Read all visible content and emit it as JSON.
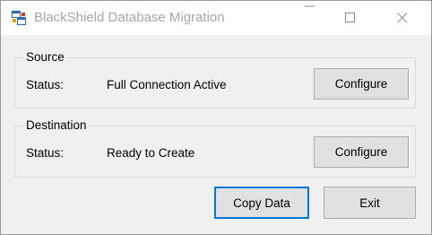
{
  "window": {
    "title": "BlackShield Database Migration",
    "icon": "app-window-icon"
  },
  "caption_buttons": {
    "minimize_icon": "minimize-icon",
    "maximize_icon": "maximize-icon",
    "close_icon": "close-icon"
  },
  "source": {
    "group_title": "Source",
    "status_label": "Status:",
    "status_value": "Full Connection Active",
    "configure_label": "Configure"
  },
  "destination": {
    "group_title": "Destination",
    "status_label": "Status:",
    "status_value": "Ready to Create",
    "configure_label": "Configure"
  },
  "actions": {
    "copy_label": "Copy Data",
    "exit_label": "Exit"
  },
  "colors": {
    "focus_border": "#0078d7",
    "button_face": "#e1e1e1",
    "window_bg": "#f0f0f0",
    "title_text": "#a6a6a6"
  }
}
